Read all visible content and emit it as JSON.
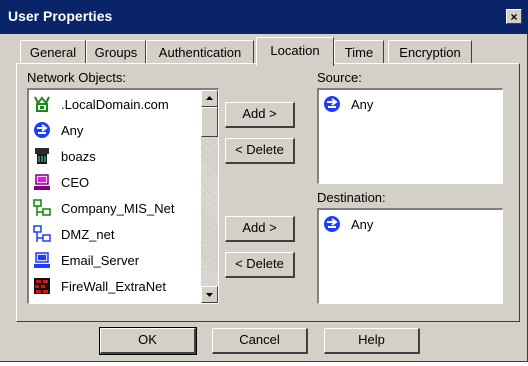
{
  "window": {
    "title": "User Properties",
    "close_glyph": "×"
  },
  "tabs": [
    {
      "label": "General",
      "active": false
    },
    {
      "label": "Groups",
      "active": false
    },
    {
      "label": "Authentication",
      "active": false
    },
    {
      "label": "Location",
      "active": true
    },
    {
      "label": "Time",
      "active": false
    },
    {
      "label": "Encryption",
      "active": false
    }
  ],
  "network_objects": {
    "label": "Network Objects:",
    "items": [
      {
        "label": ".LocalDomain.com",
        "icon": "domain-icon"
      },
      {
        "label": "Any",
        "icon": "any-icon"
      },
      {
        "label": "boazs",
        "icon": "user-icon"
      },
      {
        "label": "CEO",
        "icon": "workstation-icon"
      },
      {
        "label": "Company_MIS_Net",
        "icon": "network-icon"
      },
      {
        "label": "DMZ_net",
        "icon": "network-icon"
      },
      {
        "label": "Email_Server",
        "icon": "server-icon"
      },
      {
        "label": "FireWall_ExtraNet",
        "icon": "firewall-icon"
      }
    ]
  },
  "source": {
    "label": "Source:",
    "items": [
      {
        "label": "Any",
        "icon": "any-icon"
      }
    ],
    "add_label": "Add >",
    "delete_label": "< Delete"
  },
  "destination": {
    "label": "Destination:",
    "items": [
      {
        "label": "Any",
        "icon": "any-icon"
      }
    ],
    "add_label": "Add >",
    "delete_label": "< Delete"
  },
  "footer": {
    "ok_label": "OK",
    "cancel_label": "Cancel",
    "help_label": "Help"
  },
  "colors": {
    "title_bar": "#0a246a",
    "face": "#d4d0c8",
    "any_icon": "#1e3cff"
  }
}
